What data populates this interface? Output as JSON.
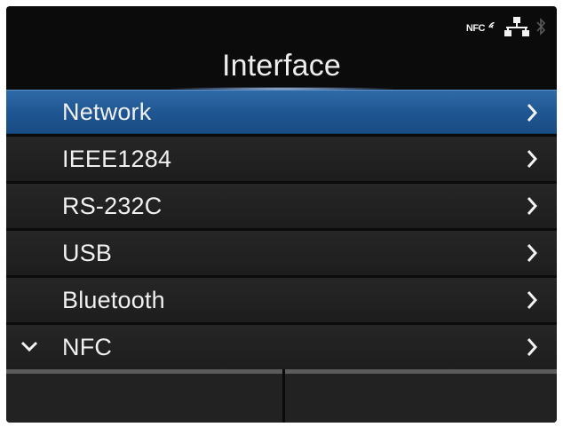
{
  "status": {
    "nfc_label": "NFC",
    "icons": [
      "nfc-icon",
      "network-icon",
      "bluetooth-icon"
    ]
  },
  "header": {
    "title": "Interface"
  },
  "menu": {
    "items": [
      {
        "label": "Network",
        "selected": true
      },
      {
        "label": "IEEE1284",
        "selected": false
      },
      {
        "label": "RS-232C",
        "selected": false
      },
      {
        "label": "USB",
        "selected": false
      },
      {
        "label": "Bluetooth",
        "selected": false
      },
      {
        "label": "NFC",
        "selected": false
      }
    ]
  },
  "colors": {
    "background": "#0b0b0b",
    "selected_row": "#1e5590",
    "row": "#232323",
    "text": "#f0f0f0"
  }
}
